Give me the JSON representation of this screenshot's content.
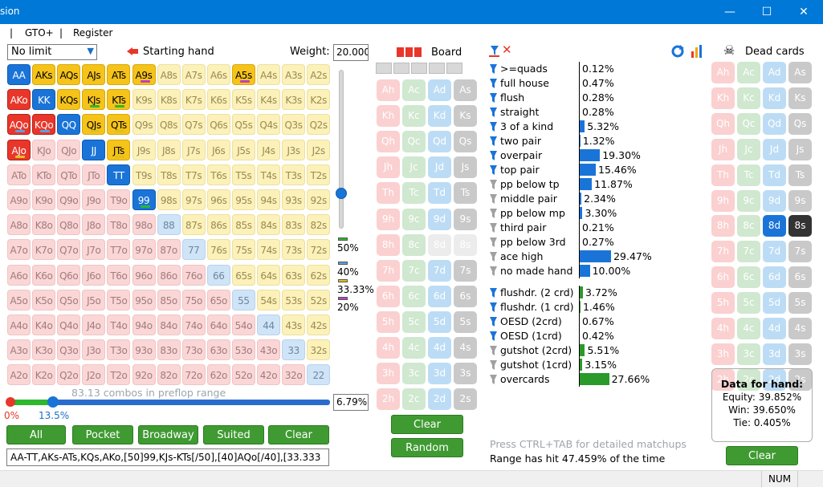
{
  "window": {
    "title": "sion",
    "min": "—",
    "max": "☐",
    "close": "✕"
  },
  "menu": {
    "sep1": "|",
    "gto": "GTO+",
    "sep2": "|",
    "register": "Register"
  },
  "hand": {
    "limit": "No limit",
    "starting_hand": "Starting hand",
    "weight_label": "Weight:",
    "weight_value": "20.000"
  },
  "grid": {
    "cells": [
      [
        "AA",
        "AKs",
        "AQs",
        "AJs",
        "ATs",
        "A9s",
        "A8s",
        "A7s",
        "A6s",
        "A5s",
        "A4s",
        "A3s",
        "A2s"
      ],
      [
        "AKo",
        "KK",
        "KQs",
        "KJs",
        "KTs",
        "K9s",
        "K8s",
        "K7s",
        "K6s",
        "K5s",
        "K4s",
        "K3s",
        "K2s"
      ],
      [
        "AQo",
        "KQo",
        "QQ",
        "QJs",
        "QTs",
        "Q9s",
        "Q8s",
        "Q7s",
        "Q6s",
        "Q5s",
        "Q4s",
        "Q3s",
        "Q2s"
      ],
      [
        "AJo",
        "KJo",
        "QJo",
        "JJ",
        "JTs",
        "J9s",
        "J8s",
        "J7s",
        "J6s",
        "J5s",
        "J4s",
        "J3s",
        "J2s"
      ],
      [
        "ATo",
        "KTo",
        "QTo",
        "JTo",
        "TT",
        "T9s",
        "T8s",
        "T7s",
        "T6s",
        "T5s",
        "T4s",
        "T3s",
        "T2s"
      ],
      [
        "A9o",
        "K9o",
        "Q9o",
        "J9o",
        "T9o",
        "99",
        "98s",
        "97s",
        "96s",
        "95s",
        "94s",
        "93s",
        "92s"
      ],
      [
        "A8o",
        "K8o",
        "Q8o",
        "J8o",
        "T8o",
        "98o",
        "88",
        "87s",
        "86s",
        "85s",
        "84s",
        "83s",
        "82s"
      ],
      [
        "A7o",
        "K7o",
        "Q7o",
        "J7o",
        "T7o",
        "97o",
        "87o",
        "77",
        "76s",
        "75s",
        "74s",
        "73s",
        "72s"
      ],
      [
        "A6o",
        "K6o",
        "Q6o",
        "J6o",
        "T6o",
        "96o",
        "86o",
        "76o",
        "66",
        "65s",
        "64s",
        "63s",
        "62s"
      ],
      [
        "A5o",
        "K5o",
        "Q5o",
        "J5o",
        "T5o",
        "95o",
        "85o",
        "75o",
        "65o",
        "55",
        "54s",
        "53s",
        "52s"
      ],
      [
        "A4o",
        "K4o",
        "Q4o",
        "J4o",
        "T4o",
        "94o",
        "84o",
        "74o",
        "64o",
        "54o",
        "44",
        "43s",
        "42s"
      ],
      [
        "A3o",
        "K3o",
        "Q3o",
        "J3o",
        "T3o",
        "93o",
        "83o",
        "73o",
        "63o",
        "53o",
        "43o",
        "33",
        "32s"
      ],
      [
        "A2o",
        "K2o",
        "Q2o",
        "J2o",
        "T2o",
        "92o",
        "82o",
        "72o",
        "62o",
        "52o",
        "42o",
        "32o",
        "22"
      ]
    ],
    "selected": [
      "AA",
      "AKs",
      "AQs",
      "AJs",
      "ATs",
      "A9s",
      "A5s",
      "AKo",
      "KK",
      "KQs",
      "KJs",
      "KTs",
      "AQo",
      "KQo",
      "QQ",
      "QJs",
      "QTs",
      "AJo",
      "JJ",
      "JTs",
      "TT",
      "99"
    ],
    "weights": {
      "A9s": "20%",
      "A5s": "20%",
      "KJs": "50%",
      "KTs": "50%",
      "AQo": "40%",
      "KQo": "40%",
      "QJs": "33.33%",
      "QTs": "33.33%",
      "AJo": "33.33%",
      "JTs": "33.33%",
      "99": "50%"
    }
  },
  "legend": [
    {
      "label": "50%",
      "color": "#2db82d"
    },
    {
      "label": "40%",
      "color": "#5aa0e0"
    },
    {
      "label": "33.33%",
      "color": "#e0c020"
    },
    {
      "label": "20%",
      "color": "#c040c0"
    }
  ],
  "slider": {
    "combos_text": "83.13 combos in preflop range",
    "min_label": "0%",
    "pos_label": "13.5%",
    "pct_value": "6.79%",
    "position": 0.135
  },
  "range_buttons": {
    "all": "All",
    "pocket": "Pocket",
    "broadway": "Broadway",
    "suited": "Suited",
    "clear": "Clear"
  },
  "range_text": "AA-TT,AKs-ATs,KQs,AKo,[50]99,KJs-KTs[/50],[40]AQo[/40],[33.333",
  "board": {
    "title": "Board",
    "clear": "Clear",
    "random": "Random"
  },
  "cards": {
    "ranks": [
      "A",
      "K",
      "Q",
      "J",
      "T",
      "9",
      "8",
      "7",
      "6",
      "5",
      "4",
      "3",
      "2"
    ],
    "suits": [
      "h",
      "c",
      "d",
      "s"
    ]
  },
  "dead": {
    "title": "Dead cards",
    "clear": "Clear",
    "selected": [
      "8d",
      "8s"
    ]
  },
  "stats": [
    {
      "label": ">=quads",
      "value": "0.12%",
      "pct": 0.12,
      "active": true,
      "bar": "blue"
    },
    {
      "label": "full house",
      "value": "0.47%",
      "pct": 0.47,
      "active": true,
      "bar": "blue"
    },
    {
      "label": "flush",
      "value": "0.28%",
      "pct": 0.28,
      "active": true,
      "bar": "blue"
    },
    {
      "label": "straight",
      "value": "0.28%",
      "pct": 0.28,
      "active": true,
      "bar": "blue"
    },
    {
      "label": "3 of a kind",
      "value": "5.32%",
      "pct": 5.32,
      "active": true,
      "bar": "blue"
    },
    {
      "label": "two pair",
      "value": "1.32%",
      "pct": 1.32,
      "active": true,
      "bar": "blue"
    },
    {
      "label": "overpair",
      "value": "19.30%",
      "pct": 19.3,
      "active": true,
      "bar": "blue"
    },
    {
      "label": "top pair",
      "value": "15.46%",
      "pct": 15.46,
      "active": true,
      "bar": "blue"
    },
    {
      "label": "pp below tp",
      "value": "11.87%",
      "pct": 11.87,
      "active": false,
      "bar": "blue"
    },
    {
      "label": "middle pair",
      "value": "2.34%",
      "pct": 2.34,
      "active": false,
      "bar": "blue"
    },
    {
      "label": "pp below mp",
      "value": "3.30%",
      "pct": 3.3,
      "active": false,
      "bar": "blue"
    },
    {
      "label": "third pair",
      "value": "0.21%",
      "pct": 0.21,
      "active": false,
      "bar": "blue"
    },
    {
      "label": "pp below 3rd",
      "value": "0.27%",
      "pct": 0.27,
      "active": false,
      "bar": "blue"
    },
    {
      "label": "ace high",
      "value": "29.47%",
      "pct": 29.47,
      "active": false,
      "bar": "blue"
    },
    {
      "label": "no made hand",
      "value": "10.00%",
      "pct": 10,
      "active": false,
      "bar": "blue"
    }
  ],
  "draws": [
    {
      "label": "flushdr. (2 crd)",
      "value": "3.72%",
      "pct": 3.72,
      "active": true
    },
    {
      "label": "flushdr. (1 crd)",
      "value": "1.46%",
      "pct": 1.46,
      "active": true
    },
    {
      "label": "OESD (2crd)",
      "value": "0.67%",
      "pct": 0.67,
      "active": true
    },
    {
      "label": "OESD (1crd)",
      "value": "0.42%",
      "pct": 0.42,
      "active": true
    },
    {
      "label": "gutshot (2crd)",
      "value": "5.51%",
      "pct": 5.51,
      "active": false
    },
    {
      "label": "gutshot (1crd)",
      "value": "3.15%",
      "pct": 3.15,
      "active": false
    },
    {
      "label": "overcards",
      "value": "27.66%",
      "pct": 27.66,
      "active": false
    }
  ],
  "footer": {
    "hint": "Press CTRL+TAB for detailed matchups",
    "hit": "Range has hit 47.459% of the time"
  },
  "handdata": {
    "title": "Data for hand:",
    "equity": "Equity: 39.852%",
    "win": "Win: 39.650%",
    "tie": "Tie: 0.405%"
  },
  "status": {
    "num": "NUM"
  },
  "colors": {
    "green": "#3f9a32",
    "blue": "#1a74d8",
    "title": "#0078d7"
  }
}
